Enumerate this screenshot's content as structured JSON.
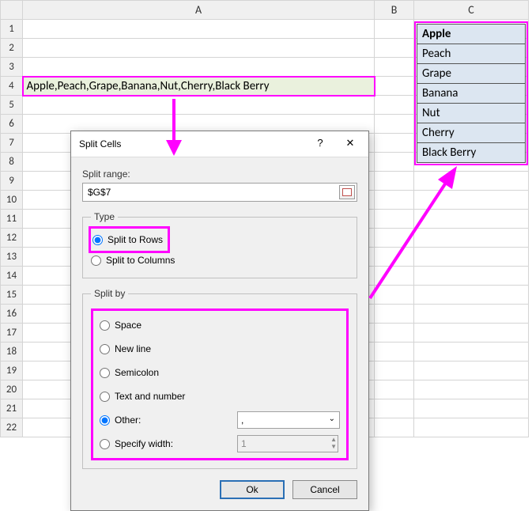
{
  "columns": [
    "A",
    "B",
    "C"
  ],
  "rows": [
    "1",
    "2",
    "3",
    "4",
    "5",
    "6",
    "7",
    "8",
    "9",
    "10",
    "11",
    "12",
    "13",
    "14",
    "15",
    "16",
    "17",
    "18",
    "19",
    "20",
    "21",
    "22"
  ],
  "cell_a4": "Apple,Peach,Grape,Banana,Nut,Cherry,Black Berry",
  "output": [
    "Apple",
    "Peach",
    "Grape",
    "Banana",
    "Nut",
    "Cherry",
    "Black Berry"
  ],
  "dialog": {
    "title": "Split Cells",
    "help": "?",
    "close": "✕",
    "range_label": "Split range:",
    "range_value": "$G$7",
    "type_legend": "Type",
    "type_rows": "Split to Rows",
    "type_cols": "Split to Columns",
    "splitby_legend": "Split by",
    "sb_space": "Space",
    "sb_newline": "New line",
    "sb_semicolon": "Semicolon",
    "sb_textnum": "Text and number",
    "sb_other": "Other:",
    "sb_other_value": ",",
    "sb_width": "Specify width:",
    "sb_width_value": "1",
    "ok": "Ok",
    "cancel": "Cancel"
  }
}
